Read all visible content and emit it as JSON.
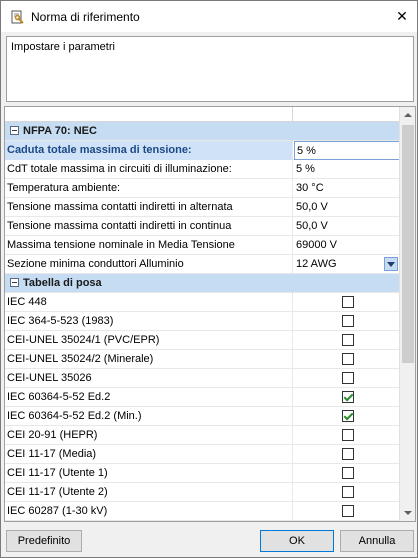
{
  "window": {
    "title": "Norma di riferimento",
    "close_glyph": "✕",
    "app_icon": "wrench-document-icon"
  },
  "description": {
    "text": "Impostare i parametri"
  },
  "grid": {
    "rows": [
      {
        "kind": "category",
        "label": "NFPA 70: NEC"
      },
      {
        "kind": "text",
        "label": "Caduta totale massima di tensione:",
        "value": "5 %",
        "selected": true
      },
      {
        "kind": "text",
        "label": "CdT totale massima in circuiti di illuminazione:",
        "value": "5 %"
      },
      {
        "kind": "text",
        "label": "Temperatura ambiente:",
        "value": "30 °C"
      },
      {
        "kind": "text",
        "label": "Tensione massima contatti indiretti in alternata",
        "value": "50,0 V"
      },
      {
        "kind": "text",
        "label": "Tensione massima contatti indiretti in continua",
        "value": "50,0 V"
      },
      {
        "kind": "text",
        "label": "Massima tensione nominale in Media Tensione",
        "value": "69000 V"
      },
      {
        "kind": "dropdown",
        "label": "Sezione minima conduttori Alluminio",
        "value": "12 AWG"
      },
      {
        "kind": "category",
        "label": "Tabella di posa"
      },
      {
        "kind": "check",
        "label": "IEC 448",
        "checked": false
      },
      {
        "kind": "check",
        "label": "IEC 364-5-523 (1983)",
        "checked": false
      },
      {
        "kind": "check",
        "label": "CEI-UNEL 35024/1 (PVC/EPR)",
        "checked": false
      },
      {
        "kind": "check",
        "label": "CEI-UNEL 35024/2 (Minerale)",
        "checked": false
      },
      {
        "kind": "check",
        "label": "CEI-UNEL 35026",
        "checked": false
      },
      {
        "kind": "check",
        "label": "IEC 60364-5-52 Ed.2",
        "checked": true
      },
      {
        "kind": "check",
        "label": "IEC 60364-5-52 Ed.2 (Min.)",
        "checked": true
      },
      {
        "kind": "check",
        "label": "CEI 20-91 (HEPR)",
        "checked": false
      },
      {
        "kind": "check",
        "label": "CEI 11-17 (Media)",
        "checked": false
      },
      {
        "kind": "check",
        "label": "CEI 11-17 (Utente 1)",
        "checked": false
      },
      {
        "kind": "check",
        "label": "CEI 11-17 (Utente 2)",
        "checked": false
      },
      {
        "kind": "check",
        "label": "IEC 60287 (1-30 kV)",
        "checked": false
      }
    ]
  },
  "buttons": {
    "default_label": "Predefinito",
    "ok_label": "OK",
    "cancel_label": "Annulla"
  },
  "colors": {
    "category_bg": "#c5dcf3",
    "selected_label": "#1c4a86",
    "check_green": "#2e8b2e",
    "primary_border": "#0078d7"
  }
}
